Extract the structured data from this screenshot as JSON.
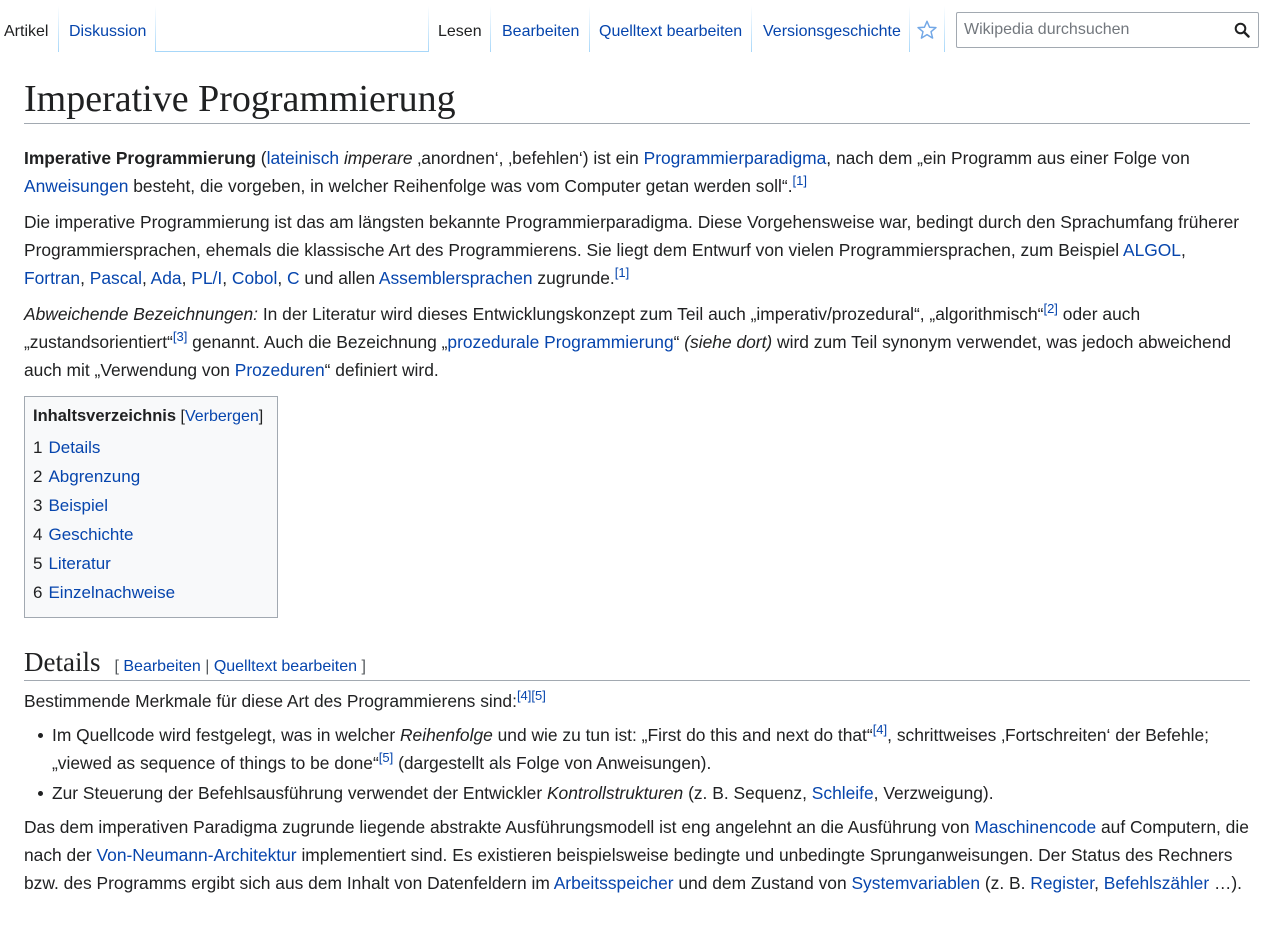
{
  "tabs": {
    "artikel": "Artikel",
    "diskussion": "Diskussion",
    "lesen": "Lesen",
    "bearbeiten": "Bearbeiten",
    "quelltext": "Quelltext bearbeiten",
    "versionen": "Versionsgeschichte"
  },
  "search": {
    "placeholder": "Wikipedia durchsuchen"
  },
  "page": {
    "title": "Imperative Programmierung"
  },
  "intro": {
    "p1": {
      "bold": "Imperative Programmierung",
      "t1": " (",
      "l1": "lateinisch",
      "t2": " ",
      "i1": "imperare",
      "t3": " ‚anordnen‘, ‚befehlen‘) ist ein ",
      "l2": "Programmierparadigma",
      "t4": ", nach dem „ein Programm aus einer Folge von ",
      "l3": "Anweisungen",
      "t5": " besteht, die vorgeben, in welcher Reihenfolge was vom Computer getan werden soll“.",
      "r1": "[1]"
    },
    "p2": {
      "t1": "Die imperative Programmierung ist das am längsten bekannte Programmierparadigma. Diese Vorgehensweise war, bedingt durch den Sprachumfang früherer Programmiersprachen, ehemals die klassische Art des Programmierens. Sie liegt dem Entwurf von vielen Programmiersprachen, zum Beispiel ",
      "l1": "ALGOL",
      "c1": ", ",
      "l2": "Fortran",
      "c2": ", ",
      "l3": "Pascal",
      "c3": ", ",
      "l4": "Ada",
      "c4": ", ",
      "l5": "PL/I",
      "c5": ", ",
      "l6": "Cobol",
      "c6": ", ",
      "l7": "C",
      "t2": " und allen ",
      "l8": "Assemblersprachen",
      "t3": " zugrunde.",
      "r1": "[1]"
    },
    "p3": {
      "i1": "Abweichende Bezeichnungen:",
      "t1": " In der Literatur wird dieses Entwicklungskonzept zum Teil auch „imperativ/prozedural“, „algorithmisch“",
      "r1": "[2]",
      "t2": " oder auch „zustandsorientiert“",
      "r2": "[3]",
      "t3": " genannt. Auch die Bezeichnung „",
      "l1": "prozedurale Programmierung",
      "t4": "“ ",
      "i2": "(siehe dort)",
      "t5": " wird zum Teil synonym verwendet, was jedoch abweichend auch mit „Verwendung von ",
      "l2": "Prozeduren",
      "t6": "“ definiert wird."
    }
  },
  "toc": {
    "title": "Inhaltsverzeichnis",
    "open": " [",
    "hide": "Verbergen",
    "close": "]",
    "items": [
      {
        "num": "1",
        "label": "Details"
      },
      {
        "num": "2",
        "label": "Abgrenzung"
      },
      {
        "num": "3",
        "label": "Beispiel"
      },
      {
        "num": "4",
        "label": "Geschichte"
      },
      {
        "num": "5",
        "label": "Literatur"
      },
      {
        "num": "6",
        "label": "Einzelnachweise"
      }
    ]
  },
  "details": {
    "heading": "Details",
    "edit_open": "[ ",
    "edit": "Bearbeiten",
    "edit_sep": " | ",
    "edit_source": "Quelltext bearbeiten",
    "edit_close": " ]",
    "p1": {
      "t1": "Bestimmende Merkmale für diese Art des Programmierens sind:",
      "r1": "[4]",
      "r2": "[5]"
    },
    "b1": {
      "t1": "Im Quellcode wird festgelegt, was in welcher ",
      "i1": "Reihenfolge",
      "t2": " und wie zu tun ist: „First do this and next do that“",
      "r1": "[4]",
      "t3": ", schrittweises ‚Fortschreiten‘ der Befehle; „viewed as sequence of things to be done“",
      "r2": "[5]",
      "t4": " (dargestellt als Folge von Anweisungen)."
    },
    "b2": {
      "t1": "Zur Steuerung der Befehlsausführung verwendet der Entwickler ",
      "i1": "Kontrollstrukturen",
      "t2": " (z. B. Sequenz, ",
      "l1": "Schleife",
      "t3": ", Verzweigung)."
    },
    "p2": {
      "t1": "Das dem imperativen Paradigma zugrunde liegende abstrakte Ausführungsmodell ist eng angelehnt an die Ausführung von ",
      "l1": "Maschinencode",
      "t2": " auf Computern, die nach der ",
      "l2": "Von-Neumann-Architektur",
      "t3": " implementiert sind. Es existieren beispielsweise bedingte und unbedingte Sprunganweisungen. Der Status des Rechners bzw. des Programms ergibt sich aus dem Inhalt von Datenfeldern im ",
      "l3": "Arbeitsspeicher",
      "t4": " und dem Zustand von ",
      "l4": "Systemvariablen",
      "t5": " (z. B. ",
      "l5": "Register",
      "c1": ", ",
      "l6": "Befehlszähler",
      "t6": " …)."
    }
  }
}
